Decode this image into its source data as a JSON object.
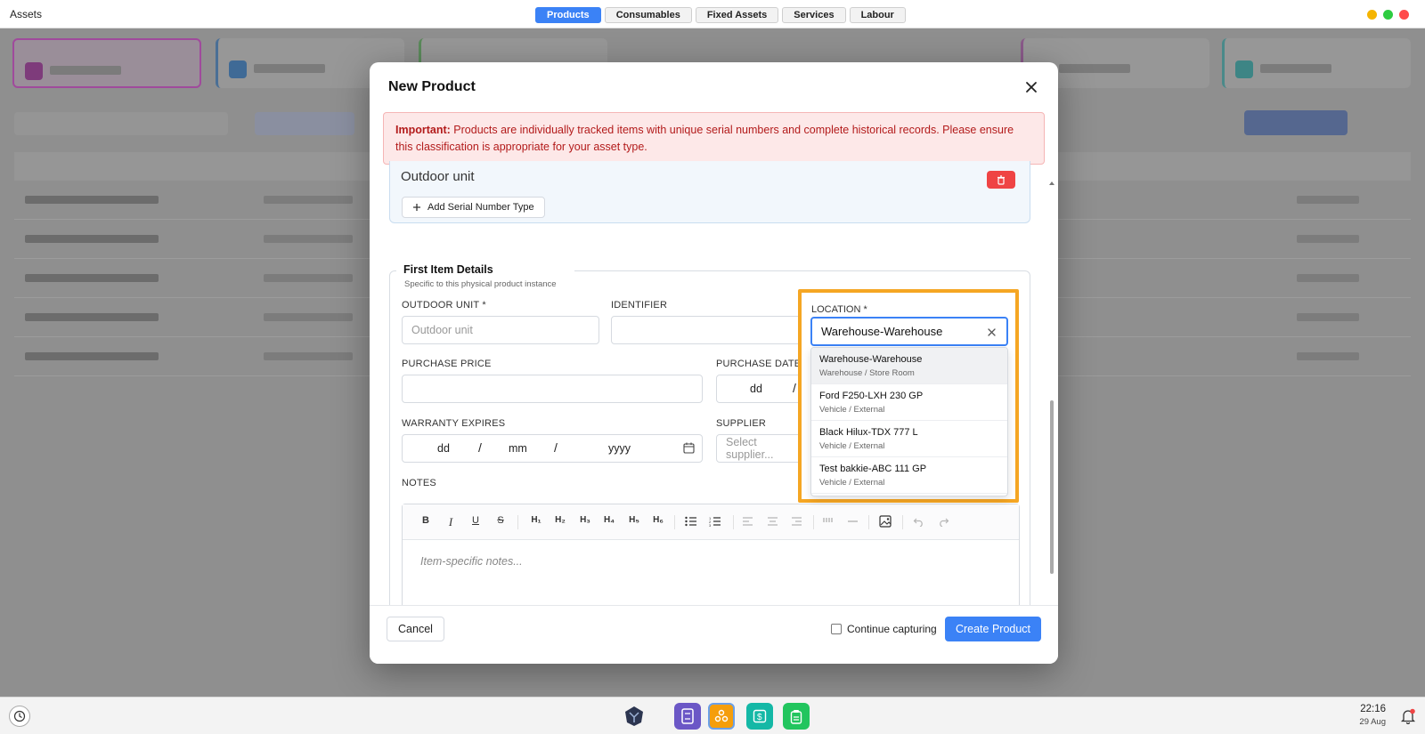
{
  "window": {
    "title": "Assets"
  },
  "tabs": [
    {
      "label": "Products",
      "active": true
    },
    {
      "label": "Consumables",
      "active": false
    },
    {
      "label": "Fixed Assets",
      "active": false
    },
    {
      "label": "Services",
      "active": false
    },
    {
      "label": "Labour",
      "active": false
    }
  ],
  "modal": {
    "title": "New Product",
    "alert": {
      "strong": "Important:",
      "text": " Products are individually tracked items with unique serial numbers and complete historical records. Please ensure this classification is appropriate for your asset type."
    },
    "serial": {
      "label": "Outdoor unit",
      "add_button": "Add Serial Number Type"
    },
    "first_item": {
      "title": "First Item Details",
      "subtitle": "Specific to this physical product instance",
      "outdoor_unit_label": "OUTDOOR UNIT *",
      "outdoor_unit_placeholder": "Outdoor unit",
      "identifier_label": "IDENTIFIER",
      "location_label": "LOCATION *",
      "location_value": "Warehouse-Warehouse",
      "purchase_price_label": "PURCHASE PRICE",
      "purchase_date_label": "PURCHASE DATE",
      "purchase_date_dd": "dd",
      "purchase_date_sep": "/",
      "warranty_label": "WARRANTY EXPIRES",
      "warranty_dd": "dd",
      "warranty_mm": "mm",
      "warranty_yyyy": "yyyy",
      "warranty_sep": "/",
      "supplier_label": "SUPPLIER",
      "supplier_placeholder": "Select supplier...",
      "notes_label": "NOTES",
      "notes_placeholder": "Item-specific notes..."
    },
    "location_options": [
      {
        "name": "Warehouse-Warehouse",
        "sub": "Warehouse / Store Room",
        "selected": true
      },
      {
        "name": "Ford F250-LXH 230 GP",
        "sub": "Vehicle / External",
        "selected": false
      },
      {
        "name": "Black Hilux-TDX 777 L",
        "sub": "Vehicle / External",
        "selected": false
      },
      {
        "name": "Test bakkie-ABC 111 GP",
        "sub": "Vehicle / External",
        "selected": false
      }
    ],
    "toolbar": {
      "bold": "B",
      "italic": "I",
      "underline": "U",
      "strike": "S",
      "h1": "H₁",
      "h2": "H₂",
      "h3": "H₃",
      "h4": "H₄",
      "h5": "H₅",
      "h6": "H₆"
    },
    "footer": {
      "cancel": "Cancel",
      "continue_label": "Continue capturing",
      "create": "Create Product"
    }
  },
  "taskbar": {
    "time": "22:16",
    "date": "29 Aug"
  },
  "colors": {
    "accent": "#3b82f6",
    "highlight": "#f5a623",
    "alert_text": "#b31b1b",
    "alert_bg": "#fde8e8"
  }
}
